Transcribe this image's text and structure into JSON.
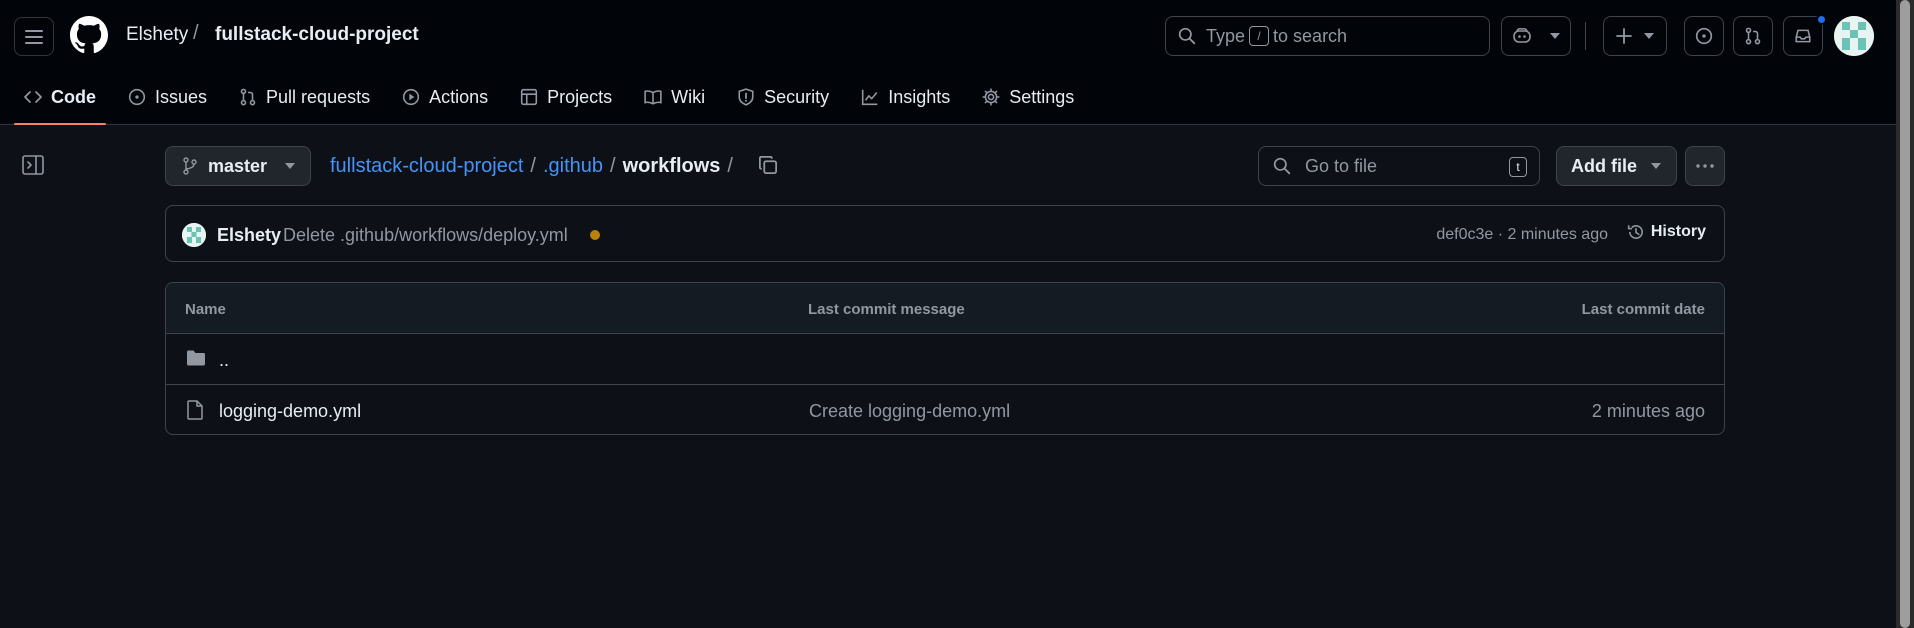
{
  "header": {
    "owner": "Elshety",
    "separator": "/",
    "repo": "fullstack-cloud-project",
    "search": {
      "prefix": "Type",
      "key": "/",
      "suffix": "to search"
    }
  },
  "tabs": [
    {
      "label": "Code",
      "icon": "code-icon",
      "active": true
    },
    {
      "label": "Issues",
      "icon": "issue-icon"
    },
    {
      "label": "Pull requests",
      "icon": "pull-request-icon"
    },
    {
      "label": "Actions",
      "icon": "play-icon"
    },
    {
      "label": "Projects",
      "icon": "table-icon"
    },
    {
      "label": "Wiki",
      "icon": "book-icon"
    },
    {
      "label": "Security",
      "icon": "shield-icon"
    },
    {
      "label": "Insights",
      "icon": "graph-icon"
    },
    {
      "label": "Settings",
      "icon": "gear-icon"
    }
  ],
  "branch": {
    "name": "master"
  },
  "path": {
    "repo": "fullstack-cloud-project",
    "dir": ".github",
    "current": "workflows",
    "sep": "/"
  },
  "gotofile": {
    "placeholder": "Go to file",
    "key": "t"
  },
  "addfile": {
    "label": "Add file"
  },
  "commit": {
    "author": "Elshety",
    "message": "Delete .github/workflows/deploy.yml",
    "status_color": "#bb8009",
    "meta": "def0c3e · 2 minutes ago",
    "history_label": "History"
  },
  "table": {
    "headers": {
      "name": "Name",
      "message": "Last commit message",
      "date": "Last commit date"
    },
    "parent": "..",
    "rows": [
      {
        "name": "logging-demo.yml",
        "message": "Create logging-demo.yml",
        "date": "2 minutes ago"
      }
    ]
  },
  "colors": {
    "accent": "#f78166",
    "link": "#4493f8",
    "bg": "#0d1117"
  }
}
